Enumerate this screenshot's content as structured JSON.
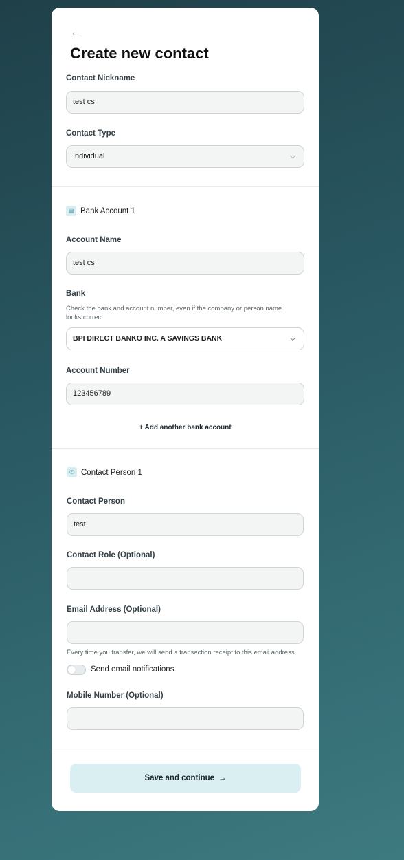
{
  "header": {
    "back_icon": "arrow-left-icon",
    "title": "Create new contact"
  },
  "contact": {
    "nickname_label": "Contact Nickname",
    "nickname_value": "test cs",
    "type_label": "Contact Type",
    "type_value": "Individual"
  },
  "bank_section": {
    "heading": "Bank Account 1",
    "icon": "bank-icon",
    "account_name_label": "Account Name",
    "account_name_value": "test cs",
    "bank_label": "Bank",
    "bank_help": "Check the bank and account number, even if the company or person name looks correct.",
    "bank_value": "BPI DIRECT BANKO INC. A SAVINGS BANK",
    "account_number_label": "Account Number",
    "account_number_value": "123456789",
    "add_another": "+ Add another bank account"
  },
  "person_section": {
    "heading": "Contact Person 1",
    "icon": "phone-icon",
    "person_label": "Contact Person",
    "person_value": "test",
    "role_label": "Contact Role (Optional)",
    "role_value": "",
    "email_label": "Email Address (Optional)",
    "email_value": "",
    "email_help": "Every time you transfer, we will send a transaction receipt to this email address.",
    "notify_label": "Send email notifications",
    "notify_on": false,
    "mobile_label": "Mobile Number (Optional)",
    "mobile_value": ""
  },
  "footer": {
    "save_label": "Save and continue",
    "save_icon": "arrow-right-icon"
  }
}
